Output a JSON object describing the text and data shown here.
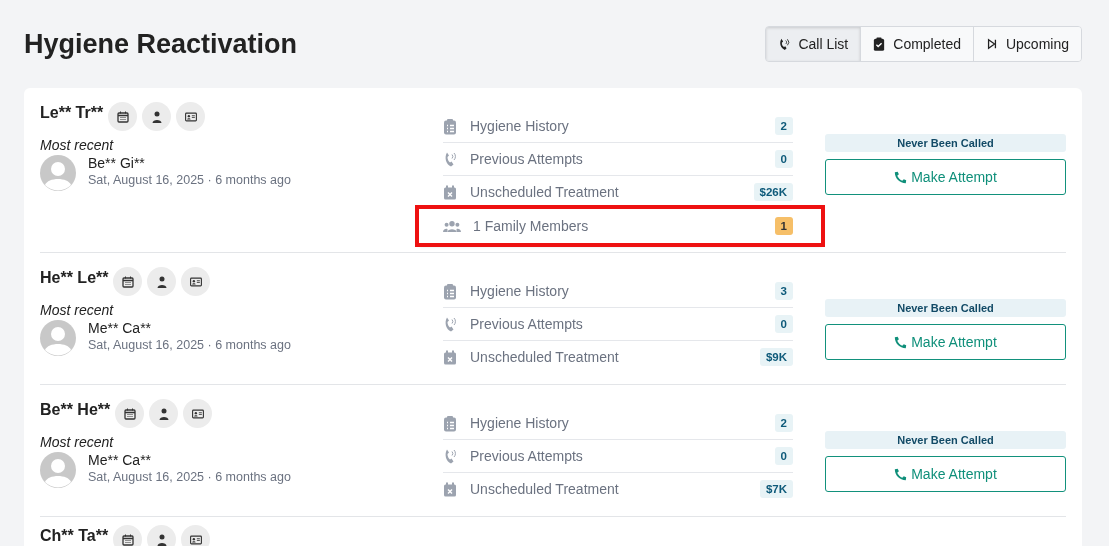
{
  "page": {
    "title": "Hygiene Reactivation"
  },
  "tabs": [
    {
      "label": "Call List",
      "selected": true
    },
    {
      "label": "Completed",
      "selected": false
    },
    {
      "label": "Upcoming",
      "selected": false
    }
  ],
  "patients": [
    {
      "name": "Le** Tr**",
      "recent_label": "Most recent",
      "provider": "Be** Gi**",
      "date": "Sat, August 16, 2025 · 6 months ago",
      "status": "Never Been Called",
      "action": "Make Attempt",
      "stats": [
        {
          "kind": "history",
          "label": "Hygiene History",
          "value": "2",
          "highlighted": false
        },
        {
          "kind": "attempts",
          "label": "Previous Attempts",
          "value": "0",
          "highlighted": false
        },
        {
          "kind": "treatment",
          "label": "Unscheduled Treatment",
          "value": "$26K",
          "highlighted": false
        },
        {
          "kind": "family",
          "label": "1 Family Members",
          "value": "1",
          "highlighted": true
        }
      ]
    },
    {
      "name": "He** Le**",
      "recent_label": "Most recent",
      "provider": "Me** Ca**",
      "date": "Sat, August 16, 2025 · 6 months ago",
      "status": "Never Been Called",
      "action": "Make Attempt",
      "stats": [
        {
          "kind": "history",
          "label": "Hygiene History",
          "value": "3",
          "highlighted": false
        },
        {
          "kind": "attempts",
          "label": "Previous Attempts",
          "value": "0",
          "highlighted": false
        },
        {
          "kind": "treatment",
          "label": "Unscheduled Treatment",
          "value": "$9K",
          "highlighted": false
        }
      ]
    },
    {
      "name": "Be** He**",
      "recent_label": "Most recent",
      "provider": "Me** Ca**",
      "date": "Sat, August 16, 2025 · 6 months ago",
      "status": "Never Been Called",
      "action": "Make Attempt",
      "stats": [
        {
          "kind": "history",
          "label": "Hygiene History",
          "value": "2",
          "highlighted": false
        },
        {
          "kind": "attempts",
          "label": "Previous Attempts",
          "value": "0",
          "highlighted": false
        },
        {
          "kind": "treatment",
          "label": "Unscheduled Treatment",
          "value": "$7K",
          "highlighted": false
        }
      ]
    },
    {
      "name": "Ch** Ta**"
    }
  ]
}
